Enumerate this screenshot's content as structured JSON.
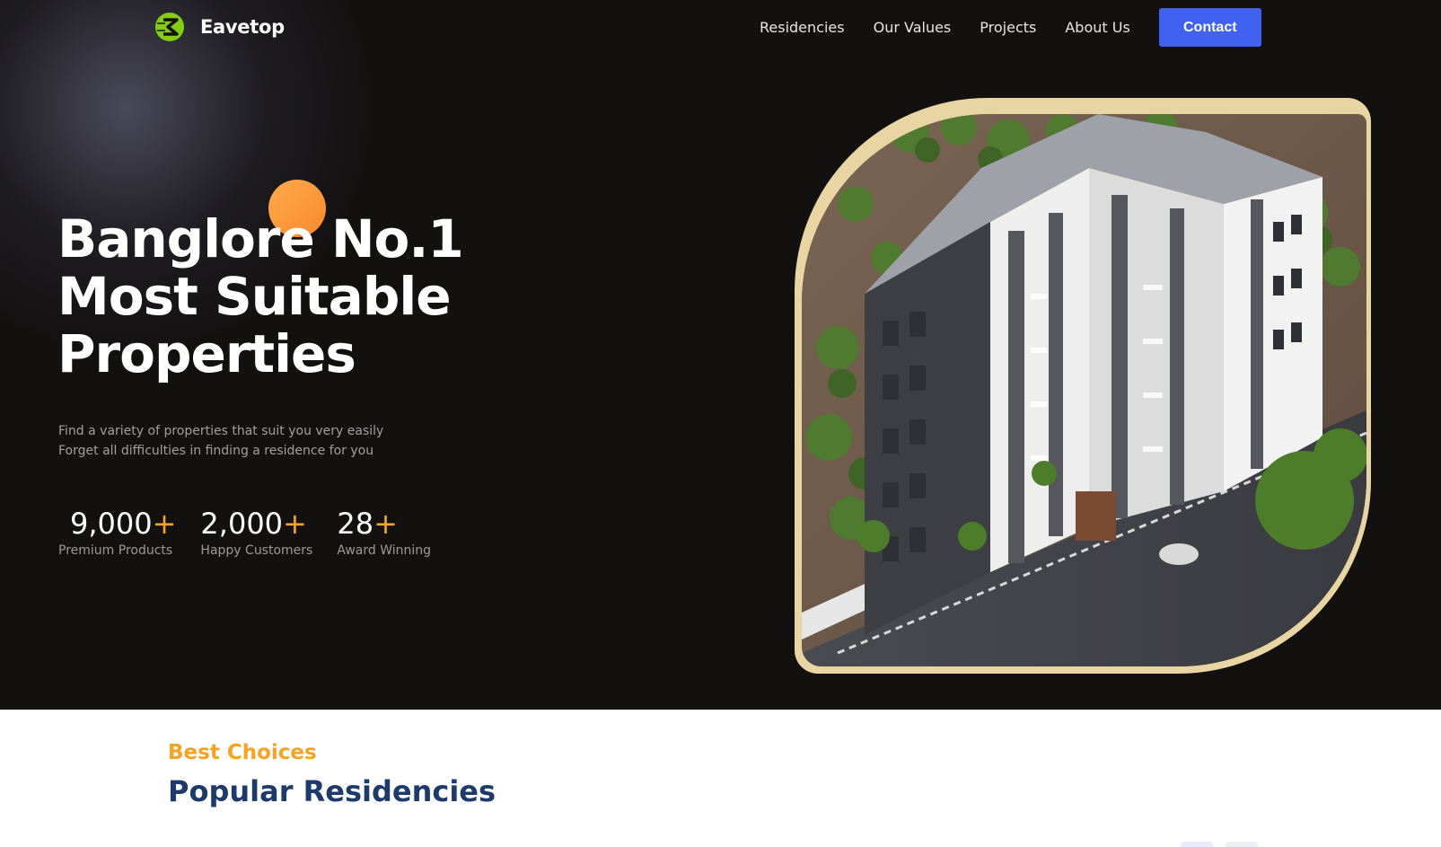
{
  "brand": {
    "name": "Eavetop",
    "accent": "#84cc16"
  },
  "nav": {
    "links": [
      "Residencies",
      "Our Values",
      "Projects",
      "About Us"
    ],
    "contact_label": "Contact",
    "contact_color": "#4161f0"
  },
  "hero": {
    "headline": [
      "Banglore No.1",
      "Most Suitable",
      "Properties"
    ],
    "subtext": [
      "Find a variety of properties that suit you very easily",
      "Forget all difficulties in finding a residence for you"
    ],
    "stats": [
      {
        "value": "9,000",
        "plus": "+",
        "label": "Premium Products"
      },
      {
        "value": "2,000",
        "plus": "+",
        "label": "Happy Customers"
      },
      {
        "value": "28",
        "plus": "+",
        "label": "Award Winning"
      }
    ],
    "accent_orange": "#f7a428"
  },
  "section": {
    "kicker": "Best Choices",
    "title": "Popular Residencies"
  }
}
